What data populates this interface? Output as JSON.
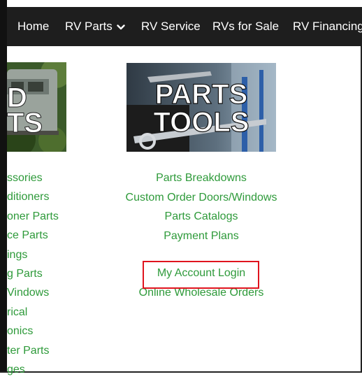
{
  "nav": {
    "items": [
      {
        "label": "Home"
      },
      {
        "label": "RV Parts"
      },
      {
        "label": "RV Service"
      },
      {
        "label": "RVs for Sale"
      },
      {
        "label": "RV Financing"
      }
    ]
  },
  "images": {
    "left": {
      "text_line1": "D",
      "text_line2": "TS"
    },
    "right": {
      "text_line1": "PARTS",
      "text_line2": "TOOLS"
    }
  },
  "left_links": [
    "ssories",
    "ditioners",
    "oner Parts",
    "ce Parts",
    "ings",
    "g Parts",
    "Vindows",
    "rical",
    "onics",
    "ter Parts",
    "ges"
  ],
  "center_links": {
    "group1": [
      "Parts Breakdowns",
      "Custom Order Doors/Windows",
      "Parts Catalogs",
      "Payment Plans"
    ],
    "group2": [
      "My Account Login",
      "Online Wholesale Orders"
    ]
  },
  "colors": {
    "nav_bg": "#1e1e1e",
    "link_green": "#2e9a3a",
    "highlight_red": "#e0141e"
  }
}
